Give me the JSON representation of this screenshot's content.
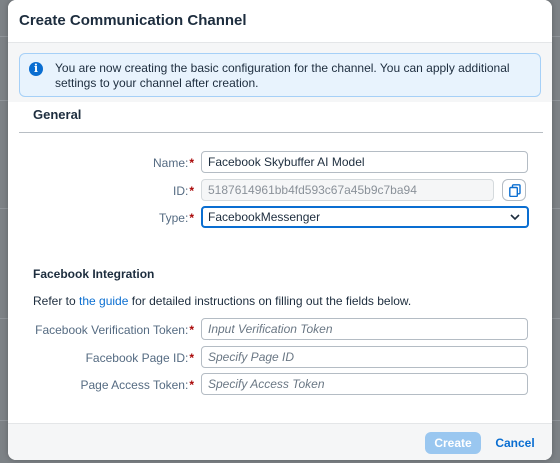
{
  "dialog": {
    "title": "Create Communication Channel",
    "info_message": "You are now creating the basic configuration for the channel. You can apply additional settings to your channel after creation."
  },
  "general": {
    "section_title": "General",
    "fields": {
      "name": {
        "label": "Name:",
        "value": "Facebook Skybuffer AI Model"
      },
      "id": {
        "label": "ID:",
        "value": "5187614961bb4fd593c67a45b9c7ba94"
      },
      "type": {
        "label": "Type:",
        "value": "FacebookMessenger"
      }
    }
  },
  "facebook": {
    "section_title": "Facebook Integration",
    "refer_prefix": "Refer to ",
    "refer_link": "the guide",
    "refer_suffix": " for detailed instructions on filling out the fields below.",
    "fields": {
      "verification_token": {
        "label": "Facebook Verification Token:",
        "placeholder": "Input Verification Token"
      },
      "page_id": {
        "label": "Facebook Page ID:",
        "placeholder": "Specify Page ID"
      },
      "access_token": {
        "label": "Page Access Token:",
        "placeholder": "Specify Access Token"
      }
    }
  },
  "footer": {
    "create_label": "Create",
    "cancel_label": "Cancel"
  },
  "required_marker": "*",
  "colors": {
    "accent": "#0a6ed1",
    "required": "#aa0808",
    "info_bg": "#e8f3fd",
    "create_disabled": "#9ac7f0"
  },
  "icons": {
    "info": "info-icon",
    "copy": "copy-icon",
    "dropdown": "chevron-down-icon"
  }
}
